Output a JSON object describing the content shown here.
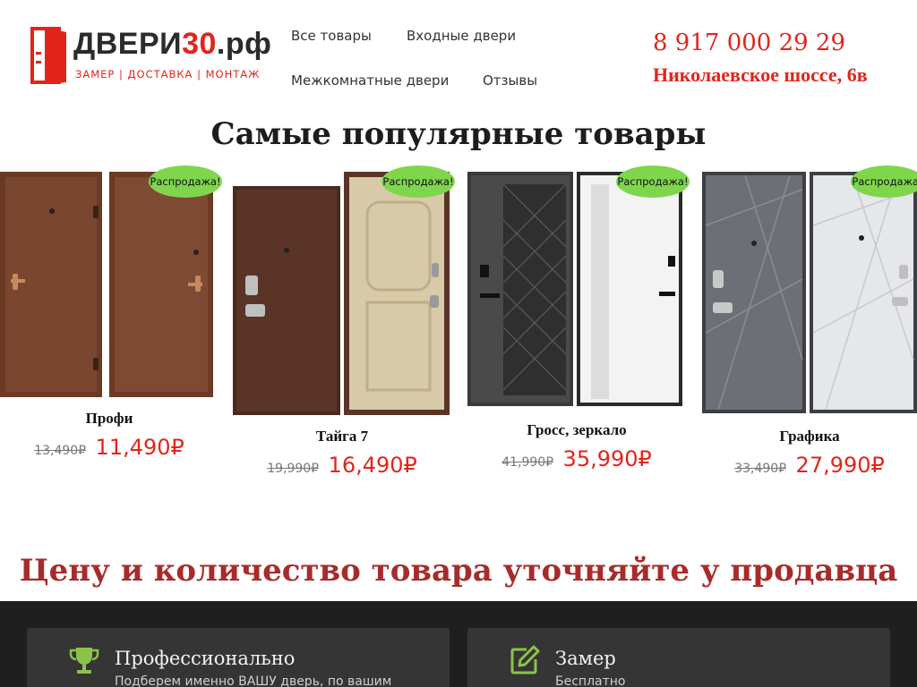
{
  "header": {
    "logo": {
      "name_main": "ДВЕРИ",
      "name_accent": "30",
      "name_suffix": ".рф",
      "tagline": "ЗАМЕР | ДОСТАВКА | МОНТАЖ"
    },
    "nav": [
      "Все товары",
      "Входные двери",
      "Межкомнатные двери",
      "Отзывы"
    ],
    "phone": "8 917 000 29 29",
    "address": "Николаевское шоссе, 6в"
  },
  "popular": {
    "title": "Самые популярные товары",
    "products": [
      {
        "name": "Профи",
        "old_price": "13,490₽",
        "price": "11,490₽",
        "badge": "Распродажа!",
        "style": "profi"
      },
      {
        "name": "Тайга 7",
        "old_price": "19,990₽",
        "price": "16,490₽",
        "badge": "Распродажа!",
        "style": "taiga"
      },
      {
        "name": "Гросс, зеркало",
        "old_price": "41,990₽",
        "price": "35,990₽",
        "badge": "Распродажа!",
        "style": "gross"
      },
      {
        "name": "Графика",
        "old_price": "33,490₽",
        "price": "27,990₽",
        "badge": "Распродажа!",
        "style": "grafika"
      }
    ]
  },
  "notice": "Цену и количество товара уточняйте у продавца",
  "features": [
    {
      "icon": "trophy-icon",
      "title": "Профессионально",
      "text": "Подберем именно ВАШУ дверь, по вашим"
    },
    {
      "icon": "edit-icon",
      "title": "Замер",
      "text": "Бесплатно"
    }
  ],
  "colors": {
    "accent": "#e1251b",
    "notice": "#a82b2b",
    "badge": "#7fd64d",
    "icon_green": "#8bc34a",
    "dark_band": "#1f1f1f",
    "feature_card": "#353535"
  }
}
